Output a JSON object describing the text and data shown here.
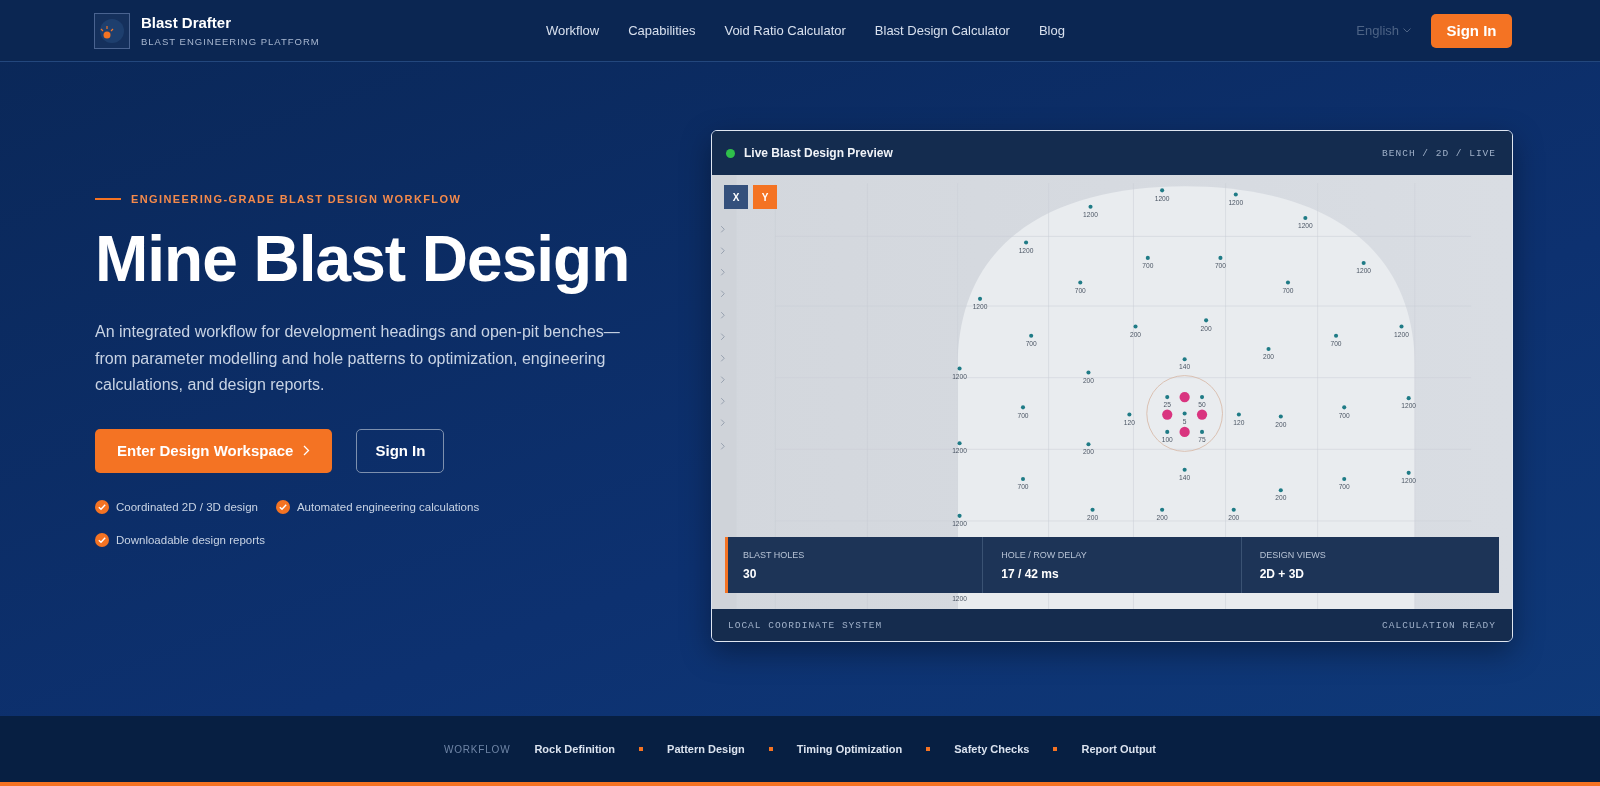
{
  "header": {
    "brand": "Blast Drafter",
    "tagline": "BLAST ENGINEERING PLATFORM",
    "nav": [
      "Workflow",
      "Capabilities",
      "Void Ratio Calculator",
      "Blast Design Calculator",
      "Blog"
    ],
    "language": "English",
    "sign_in": "Sign In"
  },
  "hero": {
    "eyebrow": "ENGINEERING-GRADE BLAST DESIGN WORKFLOW",
    "title": "Mine Blast Design",
    "description": "An integrated workflow for development headings and open-pit benches—from parameter modelling and hole patterns to optimization, engineering calculations, and design reports.",
    "primary_button": "Enter Design Workspace",
    "secondary_button": "Sign In",
    "features": [
      "Coordinated 2D / 3D design",
      "Automated engineering calculations",
      "Downloadable design reports"
    ]
  },
  "preview": {
    "title": "Live Blast Design Preview",
    "mode": "BENCH / 2D / LIVE",
    "axis_buttons": [
      {
        "label": "X",
        "selected": false
      },
      {
        "label": "Y",
        "selected": true
      }
    ],
    "hole_labels": [
      "1200",
      "1200",
      "1200",
      "1200",
      "1200",
      "1200",
      "1200",
      "1200",
      "1200",
      "1200",
      "1200",
      "1200",
      "1200",
      "1200",
      "700",
      "700",
      "700",
      "700",
      "700",
      "700",
      "700",
      "700",
      "700",
      "700",
      "200",
      "200",
      "200",
      "200",
      "200",
      "200",
      "200",
      "200",
      "200",
      "200",
      "140",
      "140",
      "120",
      "120",
      "25",
      "50",
      "5",
      "100",
      "75"
    ],
    "stats": [
      {
        "label": "BLAST HOLES",
        "value": "30",
        "selected": true
      },
      {
        "label": "HOLE / ROW DELAY",
        "value": "17 / 42 ms",
        "selected": false
      },
      {
        "label": "DESIGN VIEWS",
        "value": "2D + 3D",
        "selected": false
      }
    ],
    "footer_left": "LOCAL COORDINATE SYSTEM",
    "footer_right": "CALCULATION READY"
  },
  "workflow": {
    "label": "WORKFLOW",
    "steps": [
      "Rock Definition",
      "Pattern Design",
      "Timing Optimization",
      "Safety Checks",
      "Report Output"
    ]
  }
}
